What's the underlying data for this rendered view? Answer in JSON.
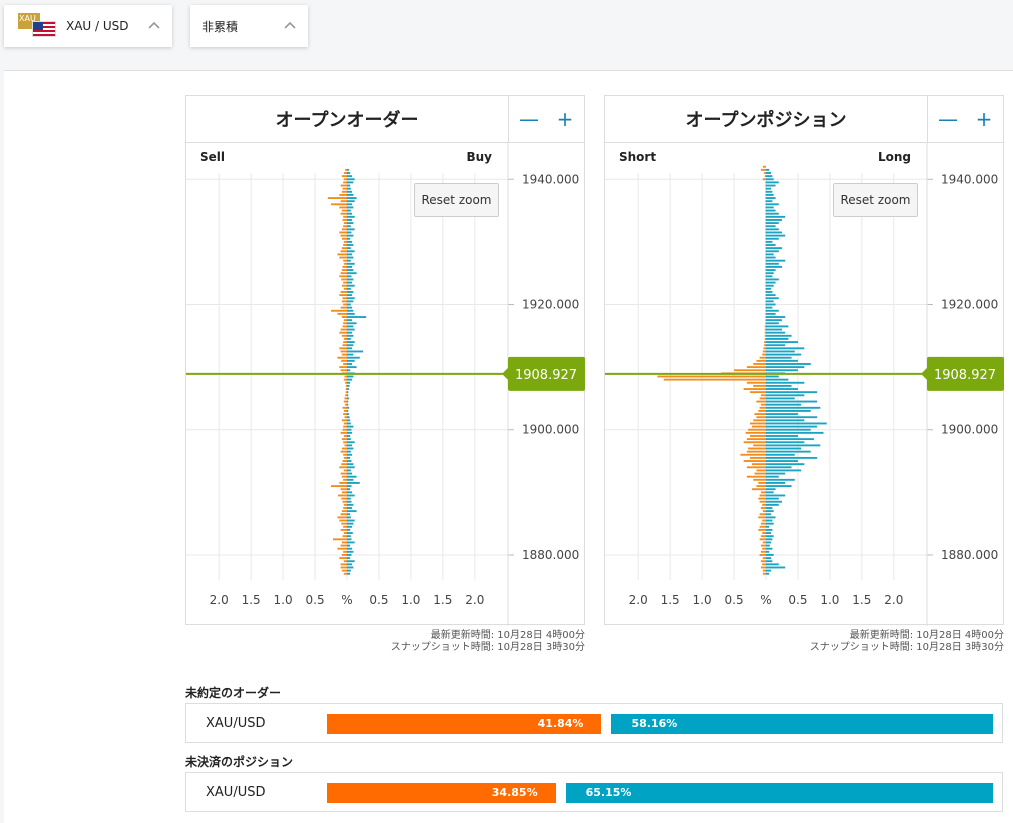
{
  "selectors": {
    "instrument": {
      "label": "XAU / USD",
      "flag_text": "XAU"
    },
    "mode": {
      "label": "非累積"
    }
  },
  "reset_zoom_label": "Reset zoom",
  "price_axis": {
    "ticks": [
      1940,
      1920,
      1900,
      1880
    ],
    "tick_labels": [
      "1940.000",
      "1920.000",
      "1900.000",
      "1880.000"
    ]
  },
  "current_price": {
    "value": 1908.927,
    "label": "1908.927",
    "color": "#7aa80d"
  },
  "pct_ticks": [
    "2.0",
    "1.5",
    "1.0",
    "0.5",
    "%",
    "0.5",
    "1.0",
    "1.5",
    "2.0"
  ],
  "colors": {
    "sell": "#f28c1e",
    "buy": "#1aa3c2",
    "sell_bar": "#ff6b00",
    "buy_bar": "#00a3c4"
  },
  "panels": [
    {
      "title": "オープンオーダー",
      "left_label": "Sell",
      "right_label": "Buy",
      "updated": "最新更新時間: 10月28日 4時00分",
      "snapshot": "スナップショット時間: 10月28日 3時30分"
    },
    {
      "title": "オープンポジション",
      "left_label": "Short",
      "right_label": "Long",
      "updated": "最新更新時間: 10月28日 4時00分",
      "snapshot": "スナップショット時間: 10月28日 3時30分"
    }
  ],
  "chart_data": [
    {
      "type": "bar",
      "orientation": "horizontal",
      "y_axis": "price",
      "ylim": [
        1876,
        1941
      ],
      "xlim_percent": [
        -2.5,
        2.5
      ],
      "price_step": 0.5,
      "series": [
        {
          "name": "Sell",
          "from": 1877,
          "values": [
            0.05,
            0.08,
            0.1,
            0.1,
            0.05,
            0.12,
            0.08,
            0.06,
            0.15,
            0.1,
            0.08,
            0.22,
            0.07,
            0.05,
            0.1,
            0.06,
            0.09,
            0.12,
            0.15,
            0.1,
            0.08,
            0.06,
            0.05,
            0.07,
            0.09,
            0.14,
            0.08,
            0.1,
            0.25,
            0.12,
            0.06,
            0.08,
            0.1,
            0.05,
            0.12,
            0.09,
            0.07,
            0.05,
            0.06,
            0.1,
            0.08,
            0.04,
            0.06,
            0.08,
            0.05,
            0.1,
            0.07,
            0.06,
            0.05,
            0.08,
            0.04,
            0.06,
            0.05,
            0.07,
            0.03,
            0.05,
            0.04,
            0.03,
            0.02,
            0.02,
            0.02,
            0.03,
            0.05,
            0.04,
            0.08,
            0.1,
            0.12,
            0.06,
            0.09,
            0.15,
            0.08,
            0.1,
            0.12,
            0.07,
            0.06,
            0.05,
            0.08,
            0.12,
            0.1,
            0.07,
            0.06,
            0.05,
            0.08,
            0.15,
            0.25,
            0.1,
            0.06,
            0.08,
            0.07,
            0.12,
            0.1,
            0.05,
            0.08,
            0.06,
            0.09,
            0.12,
            0.1,
            0.08,
            0.07,
            0.05,
            0.06,
            0.12,
            0.15,
            0.1,
            0.08,
            0.06,
            0.05,
            0.08,
            0.1,
            0.12,
            0.08,
            0.06,
            0.05,
            0.07,
            0.06,
            0.1,
            0.08,
            0.12,
            0.25,
            0.1,
            0.3,
            0.12,
            0.08,
            0.07,
            0.1,
            0.06,
            0.05,
            0.08,
            0.05,
            0.03
          ]
        },
        {
          "name": "Buy",
          "from": 1877,
          "values": [
            0.05,
            0.06,
            0.1,
            0.08,
            0.12,
            0.05,
            0.07,
            0.1,
            0.08,
            0.05,
            0.12,
            0.07,
            0.06,
            0.09,
            0.05,
            0.08,
            0.1,
            0.12,
            0.06,
            0.05,
            0.15,
            0.08,
            0.1,
            0.07,
            0.06,
            0.12,
            0.08,
            0.05,
            0.07,
            0.2,
            0.1,
            0.15,
            0.08,
            0.06,
            0.12,
            0.1,
            0.07,
            0.05,
            0.08,
            0.06,
            0.1,
            0.08,
            0.12,
            0.06,
            0.05,
            0.08,
            0.07,
            0.1,
            0.06,
            0.05,
            0.04,
            0.03,
            0.02,
            0.03,
            0.02,
            0.02,
            0.03,
            0.02,
            0.02,
            0.03,
            0.04,
            0.05,
            0.08,
            0.1,
            0.12,
            0.05,
            0.15,
            0.08,
            0.12,
            0.2,
            0.1,
            0.25,
            0.08,
            0.1,
            0.12,
            0.06,
            0.1,
            0.08,
            0.12,
            0.1,
            0.15,
            0.08,
            0.3,
            0.12,
            0.1,
            0.08,
            0.06,
            0.1,
            0.12,
            0.08,
            0.1,
            0.06,
            0.12,
            0.08,
            0.1,
            0.07,
            0.15,
            0.1,
            0.08,
            0.12,
            0.06,
            0.1,
            0.08,
            0.12,
            0.06,
            0.1,
            0.08,
            0.05,
            0.1,
            0.07,
            0.12,
            0.06,
            0.1,
            0.08,
            0.12,
            0.08,
            0.06,
            0.1,
            0.08,
            0.12,
            0.15,
            0.1,
            0.08,
            0.06,
            0.05,
            0.1,
            0.12,
            0.08,
            0.05,
            0.03
          ]
        }
      ]
    },
    {
      "type": "bar",
      "orientation": "horizontal",
      "y_axis": "price",
      "ylim": [
        1876,
        1941
      ],
      "xlim_percent": [
        -2.5,
        2.5
      ],
      "price_step": 0.5,
      "series": [
        {
          "name": "Short",
          "from": 1877,
          "values": [
            0.05,
            0.05,
            0.08,
            0.06,
            0.08,
            0.05,
            0.1,
            0.08,
            0.06,
            0.08,
            0.05,
            0.1,
            0.08,
            0.06,
            0.12,
            0.1,
            0.08,
            0.06,
            0.12,
            0.1,
            0.05,
            0.08,
            0.06,
            0.1,
            0.12,
            0.1,
            0.08,
            0.22,
            0.15,
            0.12,
            0.2,
            0.3,
            0.18,
            0.15,
            0.3,
            0.22,
            0.35,
            0.25,
            0.4,
            0.3,
            0.28,
            0.2,
            0.35,
            0.3,
            0.25,
            0.32,
            0.28,
            0.22,
            0.25,
            0.2,
            0.15,
            0.18,
            0.12,
            0.1,
            0.08,
            0.15,
            0.1,
            0.08,
            0.25,
            0.35,
            0.2,
            0.3,
            1.6,
            1.7,
            0.7,
            0.5,
            0.3,
            0.2,
            0.15,
            0.1,
            0.06,
            0.05,
            0.04,
            0.03,
            0.03,
            0.02,
            0.02,
            0.02,
            0.02,
            0.02,
            0.01,
            0.01,
            0.01,
            0.01,
            0.01,
            0.01,
            0.01,
            0.01,
            0.01,
            0.01,
            0.01,
            0.01,
            0.01,
            0.01,
            0.01,
            0.01,
            0.01,
            0.01,
            0.01,
            0.01,
            0.01,
            0.01,
            0.01,
            0.01,
            0.01,
            0.01,
            0.01,
            0.01,
            0.01,
            0.01,
            0.01,
            0.01,
            0.01,
            0.01,
            0.01,
            0.01,
            0.01,
            0.01,
            0.01,
            0.01,
            0.01,
            0.01,
            0.01,
            0.01,
            0.01,
            0.01,
            0.05,
            0.02,
            0.03,
            0.08,
            0.05
          ]
        },
        {
          "name": "Long",
          "from": 1877,
          "values": [
            0.05,
            0.08,
            0.3,
            0.2,
            0.1,
            0.08,
            0.12,
            0.05,
            0.1,
            0.06,
            0.08,
            0.1,
            0.12,
            0.08,
            0.1,
            0.05,
            0.12,
            0.1,
            0.15,
            0.08,
            0.12,
            0.1,
            0.2,
            0.25,
            0.2,
            0.3,
            0.12,
            0.15,
            0.4,
            0.3,
            0.45,
            0.2,
            0.3,
            0.55,
            0.4,
            0.6,
            0.5,
            0.8,
            0.45,
            0.7,
            0.55,
            0.85,
            0.6,
            0.75,
            0.5,
            0.9,
            0.7,
            0.8,
            0.95,
            0.6,
            0.8,
            0.5,
            0.7,
            0.85,
            0.55,
            0.8,
            0.45,
            0.6,
            0.8,
            0.5,
            0.4,
            0.6,
            0.35,
            0.2,
            0.3,
            0.5,
            0.6,
            0.7,
            0.5,
            0.4,
            0.55,
            0.45,
            0.6,
            0.3,
            0.5,
            0.35,
            0.4,
            0.3,
            0.25,
            0.35,
            0.2,
            0.25,
            0.3,
            0.15,
            0.2,
            0.1,
            0.15,
            0.12,
            0.2,
            0.15,
            0.1,
            0.08,
            0.12,
            0.15,
            0.2,
            0.1,
            0.12,
            0.15,
            0.25,
            0.2,
            0.3,
            0.15,
            0.12,
            0.2,
            0.25,
            0.15,
            0.1,
            0.2,
            0.3,
            0.25,
            0.2,
            0.15,
            0.2,
            0.25,
            0.3,
            0.2,
            0.15,
            0.12,
            0.2,
            0.1,
            0.15,
            0.12,
            0.1,
            0.08,
            0.15,
            0.2,
            0.12,
            0.1,
            0.08,
            0.05
          ]
        }
      ]
    }
  ],
  "ratio_sections": [
    {
      "title": "未約定のオーダー",
      "symbol": "XAU/USD",
      "sell_pct": 41.84,
      "sell_label": "41.84%",
      "buy_pct": 58.16,
      "buy_label": "58.16%"
    },
    {
      "title": "未決済のポジション",
      "symbol": "XAU/USD",
      "sell_pct": 34.85,
      "sell_label": "34.85%",
      "buy_pct": 65.15,
      "buy_label": "65.15%"
    }
  ]
}
